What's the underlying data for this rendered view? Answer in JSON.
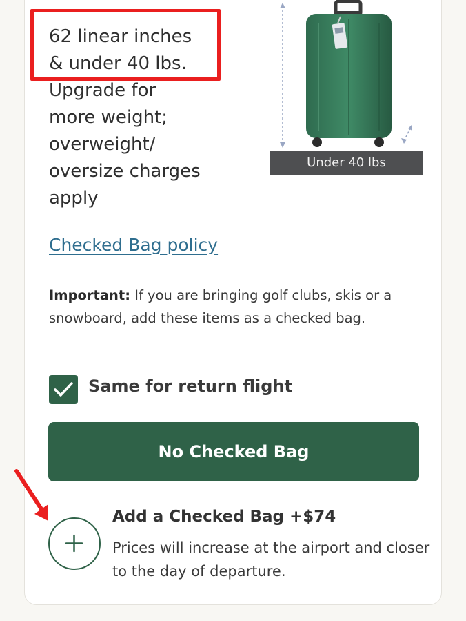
{
  "size_info": {
    "lines": [
      "62 linear inches",
      "& under 40 lbs.",
      "Upgrade for",
      "more weight;",
      "overweight/",
      "oversize charges",
      "apply"
    ]
  },
  "bag_image": {
    "weight_label": "Under 40 lbs",
    "icon": "suitcase-icon"
  },
  "policy_link": "Checked Bag policy",
  "important": {
    "label": "Important:",
    "text": " If you are bringing golf clubs, skis or a snowboard, add these items as a checked bag."
  },
  "return_option": {
    "label": "Same for return flight",
    "checked": true
  },
  "no_bag_button": "No Checked Bag",
  "add_bag": {
    "title": "Add a Checked Bag +$74",
    "description": "Prices will increase at the airport and closer to the day of departure.",
    "icon": "plus-icon"
  },
  "colors": {
    "brand_green": "#2f6248",
    "link_blue": "#2f6e8f",
    "annotation_red": "#ea1f1f"
  }
}
